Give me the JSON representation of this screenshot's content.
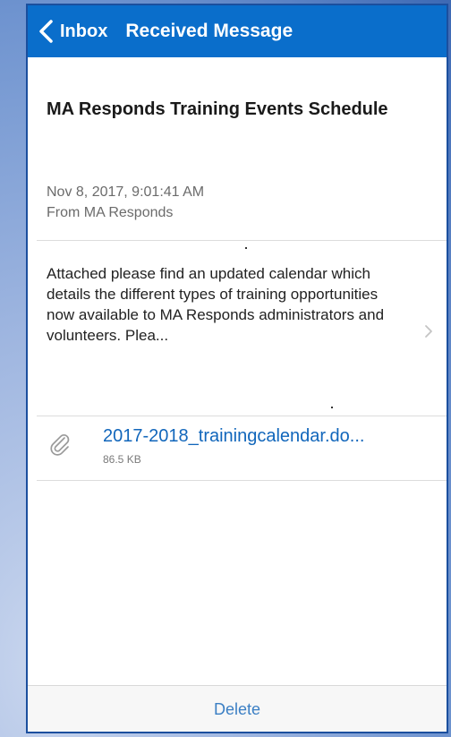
{
  "navbar": {
    "back_label": "Inbox",
    "title": "Received Message",
    "background_color": "#0a6ecb"
  },
  "message": {
    "subject": "MA Responds Training Events Schedule",
    "date": "Nov 8, 2017, 9:01:41 AM",
    "from": "From MA Responds",
    "preview": "Attached please find an updated calendar which details the different types of training opportunities now available to MA Responds administrators and volunteers. Plea..."
  },
  "attachment": {
    "filename": "2017-2018_trainingcalendar.do...",
    "size": "86.5 KB",
    "icon": "paperclip-icon"
  },
  "footer": {
    "delete_label": "Delete"
  },
  "colors": {
    "accent": "#0a6ecb",
    "link": "#1166bb",
    "delete": "#3b7fc4"
  }
}
